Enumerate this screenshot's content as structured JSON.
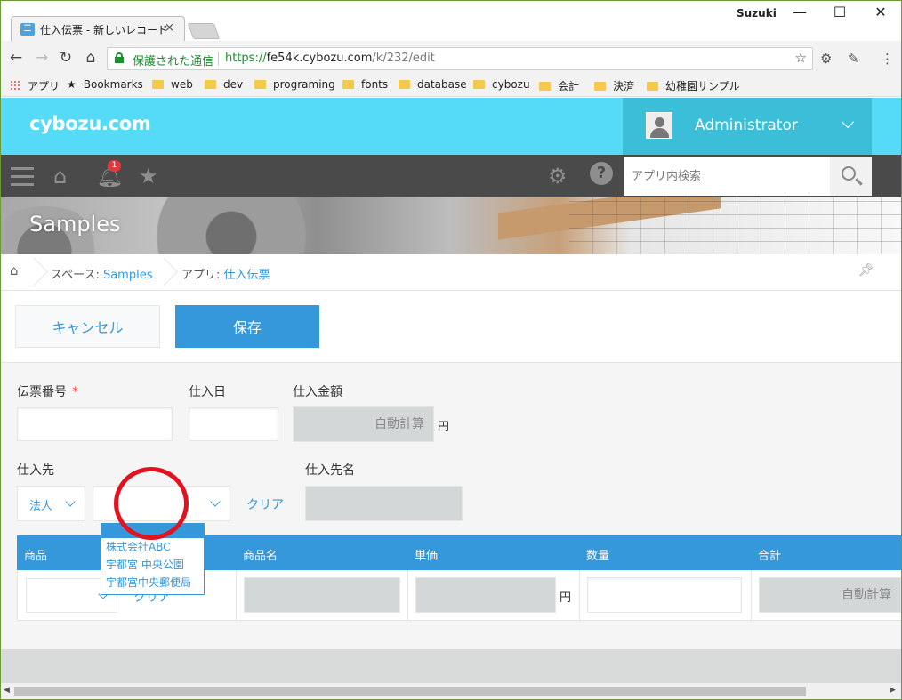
{
  "browser": {
    "tab_title": "仕入伝票 - 新しいレコード",
    "tab_close": "×",
    "user": "Suzuki",
    "secure_text": "保護された通信",
    "url_proto": "https://",
    "url_host": "fe54k.cybozu.com",
    "url_path": "/k/232/edit",
    "bookmarks": [
      "アプリ",
      "Bookmarks",
      "web",
      "dev",
      "programing",
      "fonts",
      "database",
      "cybozu",
      "会計",
      "決済",
      "幼稚園サンプル"
    ]
  },
  "header": {
    "logo": "cybozu.com",
    "user_name": "Administrator",
    "notification_count": "1",
    "search_placeholder": "アプリ内検索"
  },
  "banner": {
    "title": "Samples"
  },
  "breadcrumb": {
    "space_prefix": "スペース: ",
    "space_name": "Samples",
    "app_prefix": "アプリ: ",
    "app_name": "仕入伝票"
  },
  "actions": {
    "cancel": "キャンセル",
    "save": "保存"
  },
  "form": {
    "slip_number_label": "伝票番号",
    "required_mark": "*",
    "purchase_date_label": "仕入日",
    "amount_label": "仕入金額",
    "auto_calc": "自動計算",
    "yen": "円",
    "supplier_label": "仕入先",
    "supplier_type_value": "法人",
    "clear": "クリア",
    "supplier_name_label": "仕入先名"
  },
  "dropdown": {
    "options": [
      "株式会社ABC",
      "宇都宮 中央公園",
      "宇都宮中央郵便局"
    ]
  },
  "table": {
    "headers": [
      "商品",
      "商品名",
      "単価",
      "数量",
      "合計"
    ],
    "row": {
      "clear": "クリア",
      "yen": "円",
      "auto_calc": "自動計算"
    }
  }
}
